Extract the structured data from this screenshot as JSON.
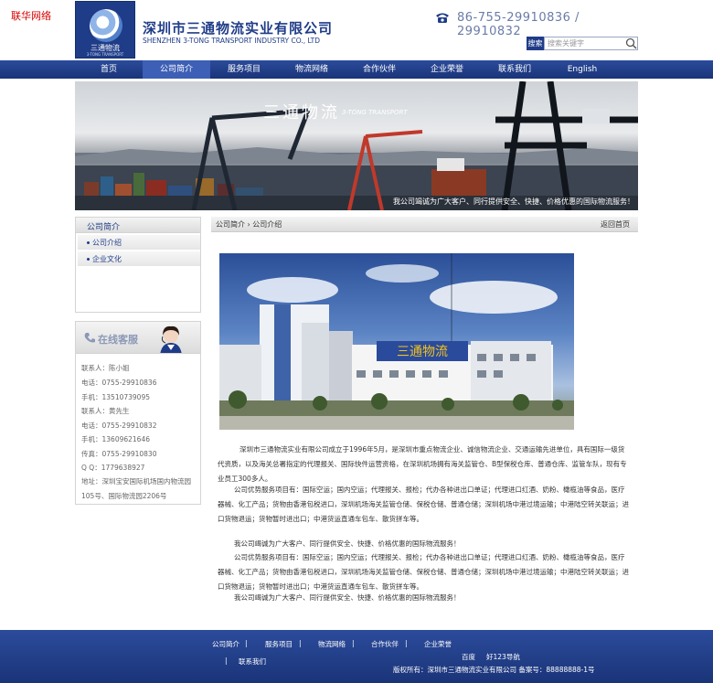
{
  "corner_text": "联华网络",
  "header": {
    "logo_caption": "三通物流",
    "logo_caption_en": "3-TONG TRANSPORT",
    "company_cn": "深圳市三通物流实业有限公司",
    "company_en": "SHENZHEN 3-TONG TRANSPORT INDUSTRY CO., LTD",
    "phone": "86-755-29910836  /  29910832",
    "search_label": "搜索",
    "search_placeholder": "搜索关键字"
  },
  "nav": {
    "items": [
      "首页",
      "公司简介",
      "服务项目",
      "物流网络",
      "合作伙伴",
      "企业荣誉",
      "联系我们",
      "English"
    ],
    "active_index": 1
  },
  "banner": {
    "title": "三通物流",
    "subtitle": "3-TONG TRANSPORT",
    "slogan": "我公司竭诚为广大客户、同行提供安全、快捷、价格优惠的国际物流服务！"
  },
  "sidebar": {
    "title": "公司简介",
    "items": [
      "公司介绍",
      "企业文化"
    ]
  },
  "customer_service": {
    "title": "在线客服",
    "lines": [
      "联系人：陈小姐",
      "电话：0755-29910836",
      "手机：13510739095",
      "联系人：黄先生",
      "电话：0755-29910832",
      "手机：13609621646",
      "传真：0755-29910830",
      "Q Q：1779638927",
      "地址：深圳宝安国际机场国内物流园",
      "105号、国际物流园2206号"
    ]
  },
  "breadcrumb": {
    "path": "公司简介  ›  公司介绍",
    "back": "返回首页"
  },
  "photo": {
    "sign_text": "三通物流"
  },
  "content": {
    "p1": "深圳市三通物流实业有限公司成立于1996年5月，是深圳市重点物流企业、诚信物流企业、交通运输先进单位，具有国际一级货代资质，以及海关总署指定的代理报关、国际快件运营资格，在深圳机场拥有海关监管仓、B型保税仓库、普通仓库、监管车队，现有专业员工300多人。",
    "p2": "公司优势服务项目有：国际空运；国内空运；代理报关、报检；代办各种进出口单证；代理进口红酒、奶粉、橄榄油等食品，医疗器械、化工产品；货物由香港包税进口，深圳机场海关监管仓储、保税仓储、普通仓储；深圳机场中港过境运输；中港陆空转关联运；进口货物退运；货物暂时进出口；中港货运直通车包车、散货拼车等。",
    "p3": "我公司竭诚为广大客户、同行提供安全、快捷、价格优惠的国际物流服务！",
    "p4": "公司优势服务项目有：国际空运；国内空运；代理报关、报检；代办各种进出口单证；代理进口红酒、奶粉、橄榄油等食品，医疗器械、化工产品；货物由香港包税进口，深圳机场海关监管仓储、保税仓储、普通仓储；深圳机场中港过境运输；中港陆空转关联运；进口货物退运；货物暂时进出口；中港货运直通车包车、散货拼车等。",
    "p5": "我公司竭诚为广大客户、同行提供安全、快捷、价格优惠的国际物流服务！"
  },
  "footer": {
    "links": [
      "公司简介",
      "服务项目",
      "物流网络",
      "合作伙伴",
      "企业荣誉",
      "联系我们"
    ],
    "link_baidu": "百度",
    "link_123": "好123导航",
    "copyright": "版权所有：深圳市三通物流实业有限公司  备案号：88888888-1号"
  },
  "colors": {
    "brand_blue": "#1f3c88",
    "nav_active": "#3d5fb5",
    "corner_red": "#d60000"
  }
}
